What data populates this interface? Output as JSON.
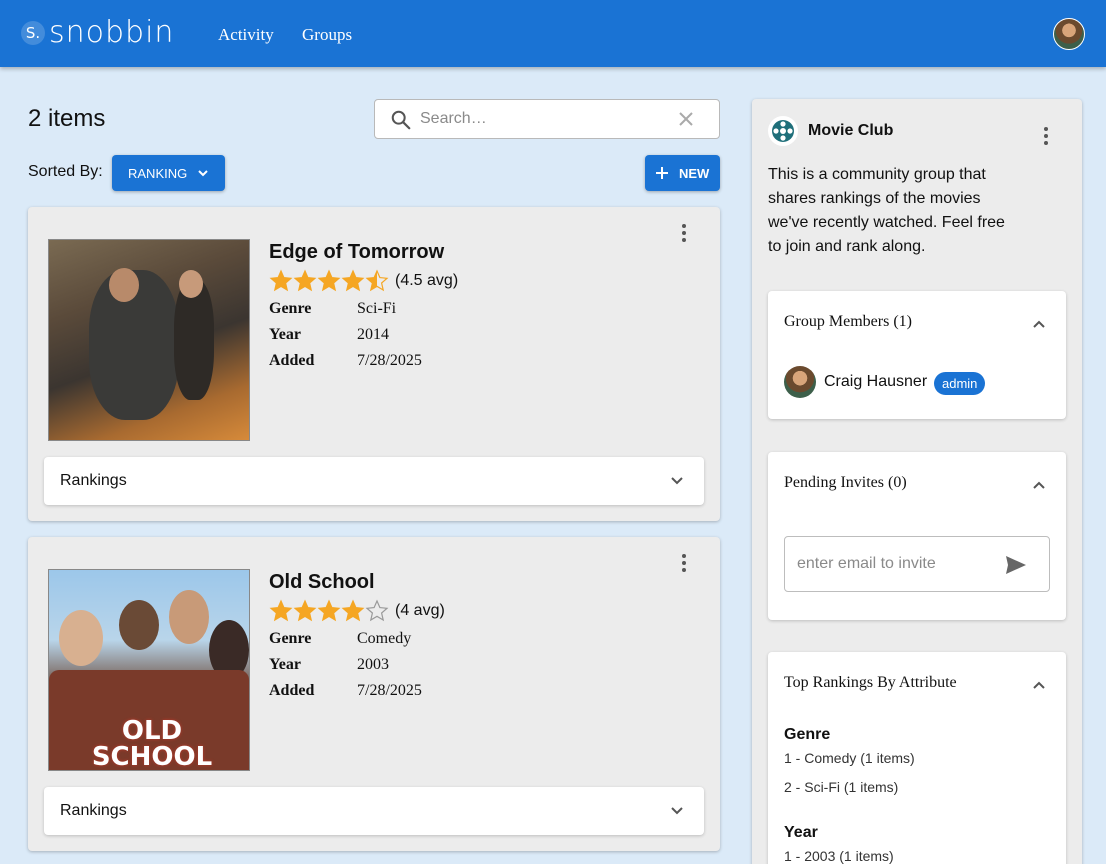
{
  "app": {
    "logo_mark": "S.",
    "logo_text": "snobbin",
    "nav": [
      "Activity",
      "Groups"
    ],
    "colors": {
      "primary": "#1a73d4",
      "star": "#f5a623",
      "page_bg": "#dbeaf8",
      "card_bg": "#ececec"
    }
  },
  "toolbar": {
    "item_count": "2 items",
    "search_placeholder": "Search…",
    "sorted_by_label": "Sorted By:",
    "sort_value": "RANKING",
    "new_label": "NEW"
  },
  "items": [
    {
      "title": "Edge of Tomorrow",
      "rating": 4.5,
      "avg_text": "(4.5 avg)",
      "attributes": [
        {
          "key": "Genre",
          "value": "Sci-Fi"
        },
        {
          "key": "Year",
          "value": "2014"
        },
        {
          "key": "Added",
          "value": "7/28/2025"
        }
      ],
      "rankings_label": "Rankings"
    },
    {
      "title": "Old School",
      "rating": 4,
      "avg_text": "(4 avg)",
      "attributes": [
        {
          "key": "Genre",
          "value": "Comedy"
        },
        {
          "key": "Year",
          "value": "2003"
        },
        {
          "key": "Added",
          "value": "7/28/2025"
        }
      ],
      "rankings_label": "Rankings",
      "poster_text": "OLD SCHOOL"
    }
  ],
  "group": {
    "name": "Movie Club",
    "description": "This is a community group that shares rankings of the movies we've recently watched. Feel free to join and rank along.",
    "members_header": "Group Members (1)",
    "members": [
      {
        "name": "Craig Hausner",
        "role": "admin"
      }
    ],
    "invites_header": "Pending Invites (0)",
    "invite_placeholder": "enter email to invite",
    "top_header": "Top Rankings By Attribute",
    "top_rankings": [
      {
        "attribute": "Genre",
        "lines": [
          "1 - Comedy (1 items)",
          "2 - Sci-Fi (1 items)"
        ]
      },
      {
        "attribute": "Year",
        "lines": [
          "1 - 2003 (1 items)"
        ]
      }
    ]
  }
}
